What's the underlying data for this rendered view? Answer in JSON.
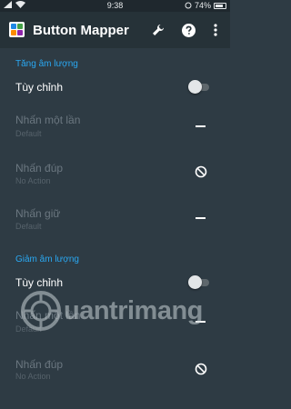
{
  "status_bar": {
    "time": "9:38",
    "battery": "74%"
  },
  "toolbar": {
    "title": "Button Mapper",
    "actions": [
      "wrench-icon",
      "help-icon",
      "overflow-menu-icon"
    ]
  },
  "sections": [
    {
      "header": "Tăng âm lượng",
      "custom_label": "Tùy chỉnh",
      "custom_enabled": false,
      "actions": [
        {
          "label": "Nhấn một lần",
          "value": "Default",
          "icon": "dash-icon"
        },
        {
          "label": "Nhấn đúp",
          "value": "No Action",
          "icon": "block-icon"
        },
        {
          "label": "Nhấn giữ",
          "value": "Default",
          "icon": "dash-icon"
        }
      ]
    },
    {
      "header": "Giảm âm lượng",
      "custom_label": "Tùy chỉnh",
      "custom_enabled": false,
      "actions": [
        {
          "label": "Nhấn một lần",
          "value": "Default",
          "icon": "dash-icon"
        },
        {
          "label": "Nhấn đúp",
          "value": "No Action",
          "icon": "block-icon"
        }
      ]
    }
  ],
  "watermark": {
    "text": "uantrimang"
  },
  "colors": {
    "background": "#2e3b44",
    "toolbar": "#263238",
    "accent": "#2aa8f2",
    "disabled_text": "#6b7780"
  }
}
